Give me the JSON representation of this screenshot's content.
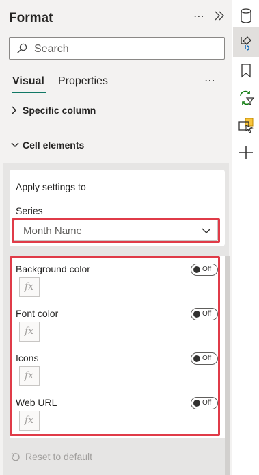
{
  "pane": {
    "title": "Format",
    "more_glyph": "⋯",
    "collapse_icon": "double-chevron-right-icon"
  },
  "search": {
    "placeholder": "Search",
    "icon": "search-icon"
  },
  "tabs": [
    {
      "label": "Visual",
      "active": true
    },
    {
      "label": "Properties",
      "active": false
    }
  ],
  "tabs_more_glyph": "⋯",
  "sections": {
    "specific_column": {
      "label": "Specific column",
      "expanded": false
    },
    "cell_elements": {
      "label": "Cell elements",
      "expanded": true
    }
  },
  "apply_settings": {
    "heading": "Apply settings to",
    "series_label": "Series",
    "series_value": "Month Name"
  },
  "options": [
    {
      "label": "Background color",
      "toggle": "Off",
      "fx": "fx"
    },
    {
      "label": "Font color",
      "toggle": "Off",
      "fx": "fx"
    },
    {
      "label": "Icons",
      "toggle": "Off",
      "fx": "fx"
    },
    {
      "label": "Web URL",
      "toggle": "Off",
      "fx": "fx"
    }
  ],
  "reset": {
    "label": "Reset to default"
  },
  "rail": {
    "icons": [
      "data-cylinder-icon",
      "format-paintbrush-icon",
      "bookmark-icon",
      "sync-filter-icon",
      "selection-pointer-icon",
      "add-icon"
    ],
    "active_index": 1
  },
  "colors": {
    "accent": "#117865",
    "highlight": "#e03b48",
    "pane_bg": "#f3f2f1"
  }
}
